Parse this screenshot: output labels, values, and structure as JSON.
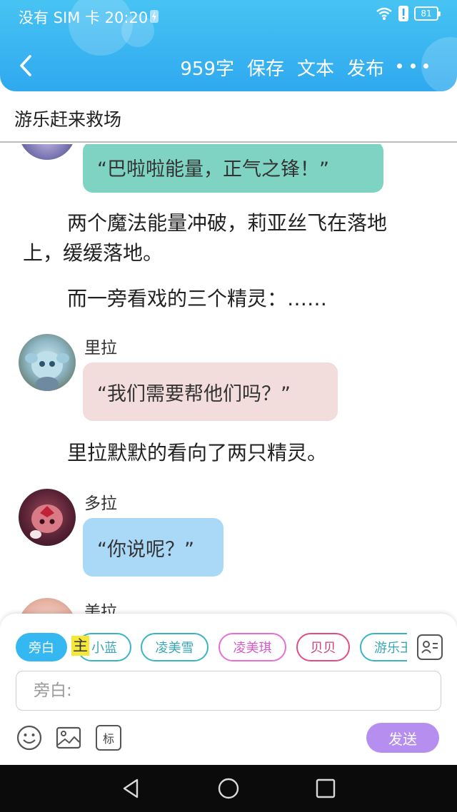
{
  "status": {
    "left_text": "没有 SIM 卡 20:20",
    "battery": "81"
  },
  "header": {
    "word_count": "959字",
    "save": "保存",
    "text": "文本",
    "publish": "发布"
  },
  "title": "游乐赶来救场",
  "messages": {
    "m1": {
      "text": "“巴啦啦能量，正气之锋！”",
      "color": "#7fd3c3"
    },
    "n1": {
      "line1": "两个魔法能量冲破，莉亚丝飞在落地",
      "line2": "上，缓缓落地。"
    },
    "n2": "而一旁看戏的三个精灵：……",
    "m2": {
      "speaker": "里拉",
      "text": "“我们需要帮他们吗？”",
      "color": "#f2dcdc"
    },
    "n3": "里拉默默的看向了两只精灵。",
    "m3": {
      "speaker": "多拉",
      "text": "“你说呢？”",
      "color": "#a9d9f7"
    },
    "m4": {
      "speaker": "美拉"
    }
  },
  "input": {
    "roles": [
      "旁白",
      "小蓝",
      "凌美雪",
      "凌美琪",
      "贝贝",
      "游乐王子"
    ],
    "highlight": "主",
    "placeholder": "旁白:",
    "tag_icon_label": "标",
    "send": "发送"
  }
}
